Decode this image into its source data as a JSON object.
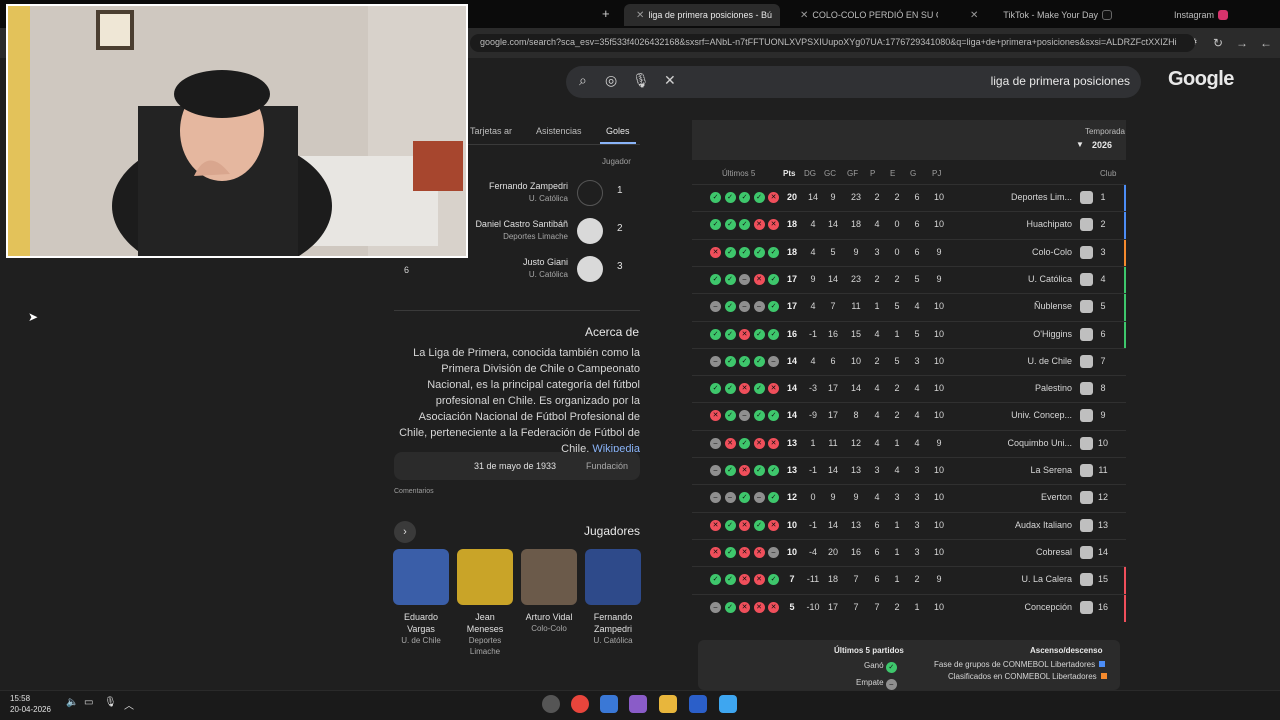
{
  "tabs": [
    {
      "label": "Instagram"
    },
    {
      "label": "TikTok - Make Your Day"
    },
    {
      "label": "COLO-COLO PERDIÓ EN SU CU"
    },
    {
      "label": "liga de primera posiciones - Bú"
    }
  ],
  "url": "google.com/search?sca_esv=35f533f4026432168&sxsrf=ANbL-n7tFFTUONLXVPSXIUupoXYg07UA:1776729341080&q=liga+de+primera+posiciones&sxsi=ALDRZFctXXIZHi",
  "google_logo": "Google",
  "search_query": "liga de primera posiciones",
  "season": {
    "label": "Temporada",
    "value": "2026"
  },
  "headers": {
    "club": "Club",
    "pj": "PJ",
    "g": "G",
    "e": "E",
    "p": "P",
    "gf": "GF",
    "gc": "GC",
    "dg": "DG",
    "pts": "Pts",
    "last5": "Últimos 5"
  },
  "standings": [
    {
      "pos": "1",
      "club": "Deportes Lim...",
      "pj": "10",
      "g": "6",
      "e": "2",
      "p": "2",
      "gf": "23",
      "gc": "9",
      "dg": "14",
      "pts": "20",
      "form": [
        "l",
        "w",
        "w",
        "w",
        "w"
      ],
      "mark": "#4c8df6"
    },
    {
      "pos": "2",
      "club": "Huachipato",
      "pj": "10",
      "g": "6",
      "e": "0",
      "p": "4",
      "gf": "18",
      "gc": "14",
      "dg": "4",
      "pts": "18",
      "form": [
        "l",
        "l",
        "w",
        "w",
        "w"
      ],
      "mark": "#4c8df6"
    },
    {
      "pos": "3",
      "club": "Colo-Colo",
      "pj": "9",
      "g": "6",
      "e": "0",
      "p": "3",
      "gf": "9",
      "gc": "5",
      "dg": "4",
      "pts": "18",
      "form": [
        "w",
        "w",
        "w",
        "w",
        "l"
      ],
      "mark": "#f58a2d"
    },
    {
      "pos": "4",
      "club": "U. Católica",
      "pj": "9",
      "g": "5",
      "e": "2",
      "p": "2",
      "gf": "23",
      "gc": "14",
      "dg": "9",
      "pts": "17",
      "form": [
        "w",
        "l",
        "d",
        "w",
        "w"
      ],
      "mark": "#3ec76c"
    },
    {
      "pos": "5",
      "club": "Ñublense",
      "pj": "10",
      "g": "4",
      "e": "5",
      "p": "1",
      "gf": "11",
      "gc": "7",
      "dg": "4",
      "pts": "17",
      "form": [
        "w",
        "d",
        "d",
        "w",
        "d"
      ],
      "mark": "#3ec76c"
    },
    {
      "pos": "6",
      "club": "O'Higgins",
      "pj": "10",
      "g": "5",
      "e": "1",
      "p": "4",
      "gf": "15",
      "gc": "16",
      "dg": "-1",
      "pts": "16",
      "form": [
        "w",
        "w",
        "l",
        "w",
        "w"
      ],
      "mark": "#3ec76c"
    },
    {
      "pos": "7",
      "club": "U. de Chile",
      "pj": "10",
      "g": "3",
      "e": "5",
      "p": "2",
      "gf": "10",
      "gc": "6",
      "dg": "4",
      "pts": "14",
      "form": [
        "d",
        "w",
        "w",
        "w",
        "d"
      ],
      "mark": ""
    },
    {
      "pos": "8",
      "club": "Palestino",
      "pj": "10",
      "g": "4",
      "e": "2",
      "p": "4",
      "gf": "14",
      "gc": "17",
      "dg": "-3",
      "pts": "14",
      "form": [
        "l",
        "w",
        "l",
        "w",
        "w"
      ],
      "mark": ""
    },
    {
      "pos": "9",
      "club": "Univ. Concep...",
      "pj": "10",
      "g": "4",
      "e": "2",
      "p": "4",
      "gf": "8",
      "gc": "17",
      "dg": "-9",
      "pts": "14",
      "form": [
        "w",
        "w",
        "d",
        "w",
        "l"
      ],
      "mark": ""
    },
    {
      "pos": "10",
      "club": "Coquimbo Uni...",
      "pj": "9",
      "g": "4",
      "e": "1",
      "p": "4",
      "gf": "12",
      "gc": "11",
      "dg": "1",
      "pts": "13",
      "form": [
        "l",
        "l",
        "w",
        "l",
        "d"
      ],
      "mark": ""
    },
    {
      "pos": "11",
      "club": "La Serena",
      "pj": "10",
      "g": "3",
      "e": "4",
      "p": "3",
      "gf": "13",
      "gc": "14",
      "dg": "-1",
      "pts": "13",
      "form": [
        "w",
        "w",
        "l",
        "w",
        "d"
      ],
      "mark": ""
    },
    {
      "pos": "12",
      "club": "Everton",
      "pj": "10",
      "g": "3",
      "e": "3",
      "p": "4",
      "gf": "9",
      "gc": "9",
      "dg": "0",
      "pts": "12",
      "form": [
        "w",
        "d",
        "w",
        "d",
        "d"
      ],
      "mark": ""
    },
    {
      "pos": "13",
      "club": "Audax Italiano",
      "pj": "10",
      "g": "3",
      "e": "1",
      "p": "6",
      "gf": "13",
      "gc": "14",
      "dg": "-1",
      "pts": "10",
      "form": [
        "l",
        "w",
        "l",
        "w",
        "l"
      ],
      "mark": ""
    },
    {
      "pos": "14",
      "club": "Cobresal",
      "pj": "10",
      "g": "3",
      "e": "1",
      "p": "6",
      "gf": "16",
      "gc": "20",
      "dg": "-4",
      "pts": "10",
      "form": [
        "d",
        "l",
        "l",
        "w",
        "l"
      ],
      "mark": ""
    },
    {
      "pos": "15",
      "club": "U. La Calera",
      "pj": "9",
      "g": "2",
      "e": "1",
      "p": "6",
      "gf": "7",
      "gc": "18",
      "dg": "-11",
      "pts": "7",
      "form": [
        "w",
        "l",
        "l",
        "w",
        "w"
      ],
      "mark": "#f04f5b"
    },
    {
      "pos": "16",
      "club": "Concepción",
      "pj": "10",
      "g": "1",
      "e": "2",
      "p": "7",
      "gf": "7",
      "gc": "17",
      "dg": "-10",
      "pts": "5",
      "form": [
        "l",
        "l",
        "l",
        "w",
        "d"
      ],
      "mark": "#f04f5b"
    }
  ],
  "legend": {
    "title_left": "Ascenso/descenso",
    "title_right": "Últimos 5 partidos",
    "items": [
      "Fase de grupos de CONMEBOL Libertadores",
      "Clasificados en CONMEBOL Libertadores"
    ],
    "form_items": [
      "Ganó",
      "Empate"
    ],
    "colors": [
      "#4c8df6",
      "#f58a2d"
    ]
  },
  "stats": {
    "tabs": [
      "Goles",
      "Asistencias",
      "Tarjetas ar"
    ],
    "col_header": "Jugador",
    "players": [
      {
        "rank": "1",
        "name": "Fernando Zampedri",
        "team": "U. Católica",
        "value": ""
      },
      {
        "rank": "2",
        "name": "Daniel Castro Santibáñ",
        "team": "Deportes Limache",
        "value": ""
      },
      {
        "rank": "3",
        "name": "Justo Giani",
        "team": "U. Católica",
        "value": "6"
      }
    ]
  },
  "about": {
    "title": "Acerca de",
    "text": "La Liga de Primera, conocida también como la Primera División de Chile o Campeonato Nacional, es la principal categoría del fútbol profesional en Chile. Es organizado por la Asociación Nacional de Fútbol Profesional de Chile, perteneciente a la Federación de Fútbol de Chile.",
    "wiki_link": "Wikipedia",
    "founded_label": "Fundación",
    "founded_value": "31 de mayo de 1933",
    "comments": "Comentarios"
  },
  "players_section": {
    "title": "Jugadores",
    "cards": [
      {
        "name": "Fernando Zampedri",
        "team": "U. Católica",
        "photo": "#2e4a8a"
      },
      {
        "name": "Arturo Vidal",
        "team": "Colo-Colo",
        "photo": "#6b5a4a"
      },
      {
        "name": "Jean Meneses",
        "team": "Deportes Limache",
        "photo": "#c9a428"
      },
      {
        "name": "Eduardo Vargas",
        "team": "U. de Chile",
        "photo": "#3a5ea8"
      }
    ]
  },
  "clock": {
    "time": "15:58",
    "date": "20-04-2026"
  }
}
